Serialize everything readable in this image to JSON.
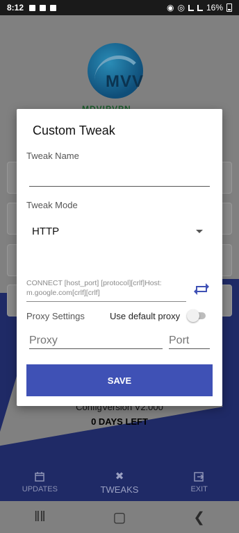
{
  "status_bar": {
    "time": "8:12",
    "battery": "16%"
  },
  "app": {
    "logo_text": "MVV",
    "logo_subtext": "MDVIPVPN",
    "config_version": "ConfigVersion V2.000",
    "days_left": "0 DAYS LEFT"
  },
  "dialog": {
    "title": "Custom Tweak",
    "tweak_name_label": "Tweak Name",
    "tweak_name_value": "",
    "tweak_mode_label": "Tweak Mode",
    "tweak_mode_value": "HTTP",
    "payload": "CONNECT [host_port] [protocol][crlf]Host: m.google.com[crlf][crlf]",
    "proxy_settings_label": "Proxy Settings",
    "default_proxy_label": "Use default proxy",
    "default_proxy_enabled": false,
    "proxy_placeholder": "Proxy",
    "port_placeholder": "Port",
    "save_label": "SAVE"
  },
  "bottom_nav": {
    "items": [
      {
        "label": "UPDATES",
        "icon": "calendar-icon"
      },
      {
        "label": "TWEAKS",
        "icon": "tools-icon"
      },
      {
        "label": "EXIT",
        "icon": "exit-icon"
      }
    ],
    "active": "TWEAKS"
  },
  "colors": {
    "accent": "#3f51b5",
    "nav_background": "#1f2a66",
    "dialog_background": "#ffffff"
  }
}
